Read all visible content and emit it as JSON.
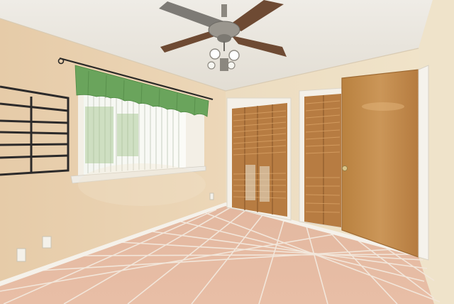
{
  "scene": {
    "kind": "photo",
    "subject": "empty-bedroom",
    "palette": {
      "wall": "#e8d2b2",
      "wall_right": "#efe2c8",
      "ceiling": "#ece8e0",
      "floor_tile": "#e4b69e",
      "grout": "#f1e3d6",
      "trim": "#f3efe8",
      "door_wood": "#c18a4e",
      "louver_wood": "#b57a40",
      "valance": "#6aa45c",
      "shelf": "#2c2a2a",
      "fan_blade": "#6e4a33",
      "fan_metal": "#8b877f"
    }
  }
}
